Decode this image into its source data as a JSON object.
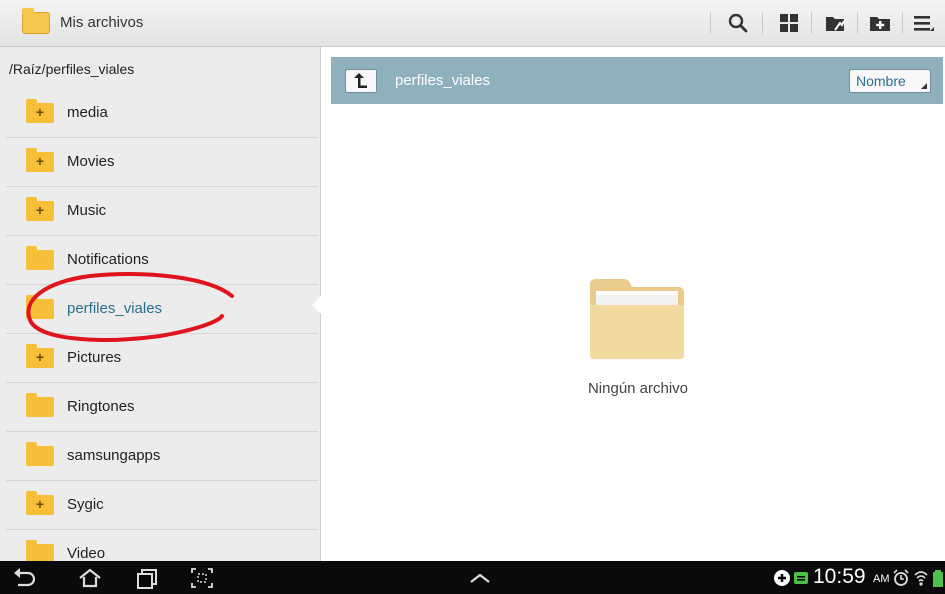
{
  "app": {
    "title": "Mis archivos"
  },
  "toolbar": {
    "icons": [
      "search-icon",
      "grid-view-icon",
      "move-folder-icon",
      "new-folder-icon",
      "menu-icon"
    ]
  },
  "sidebar": {
    "path": "/Raíz/perfiles_viales",
    "items": [
      {
        "label": "media",
        "has_subfolders": true
      },
      {
        "label": "Movies",
        "has_subfolders": true
      },
      {
        "label": "Music",
        "has_subfolders": true
      },
      {
        "label": "Notifications",
        "has_subfolders": false
      },
      {
        "label": "perfiles_viales",
        "has_subfolders": false,
        "selected": true
      },
      {
        "label": "Pictures",
        "has_subfolders": true
      },
      {
        "label": "Ringtones",
        "has_subfolders": false
      },
      {
        "label": "samsungapps",
        "has_subfolders": false
      },
      {
        "label": "Sygic",
        "has_subfolders": true
      },
      {
        "label": "Video",
        "has_subfolders": false
      }
    ],
    "plus_glyph": "+"
  },
  "main": {
    "current_folder": "perfiles_viales",
    "sort_label": "Nombre",
    "empty_text": "Ningún archivo"
  },
  "statusbar": {
    "time": "10:59",
    "ampm": "AM"
  },
  "colors": {
    "folder": "#f7be37",
    "header_bar": "#8fb0bd",
    "selected_text": "#2b6f8f",
    "annotation": "#e0141c"
  }
}
